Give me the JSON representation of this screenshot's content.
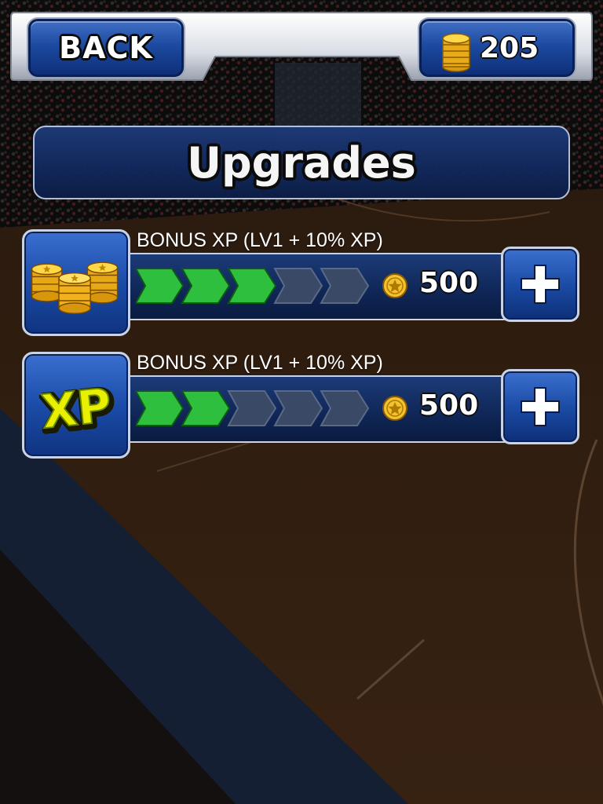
{
  "header": {
    "back_label": "BACK",
    "coin_balance": "205"
  },
  "title": "Upgrades",
  "upgrades": [
    {
      "label": "BONUS XP (LV1 + 10% XP)",
      "icon": "coin-stacks-icon",
      "levels_filled": 3,
      "levels_total": 5,
      "price": "500"
    },
    {
      "label": "BONUS XP (LV1 + 10% XP)",
      "icon": "xp-icon",
      "levels_filled": 2,
      "levels_total": 5,
      "price": "500"
    }
  ],
  "colors": {
    "panel_blue": "#132a5f",
    "button_blue": "#1c4aa0",
    "segment_filled": "#2fbf3f",
    "segment_empty": "#3a4a66",
    "coin_gold": "#f2c230",
    "xp_yellow": "#e8f000"
  }
}
